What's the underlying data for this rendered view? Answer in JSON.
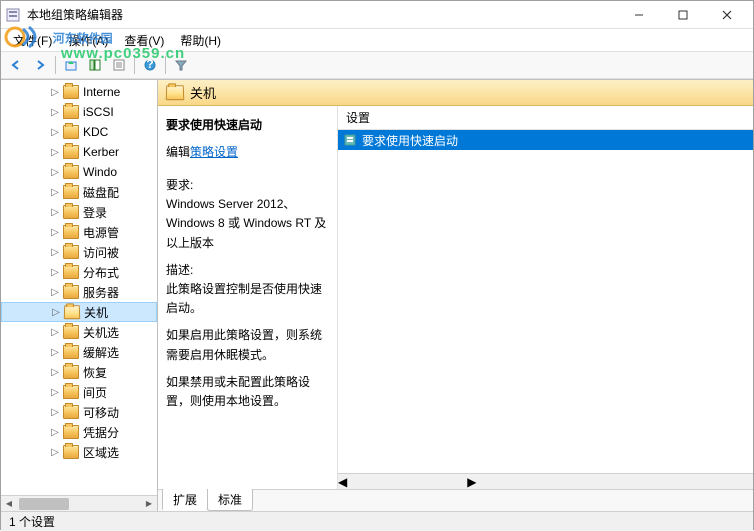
{
  "window": {
    "title": "本地组策略编辑器"
  },
  "menu": {
    "file": "文件(F)",
    "action": "操作(A)",
    "view": "查看(V)",
    "help": "帮助(H)"
  },
  "tree": {
    "items": [
      {
        "label": "Interne"
      },
      {
        "label": "iSCSI"
      },
      {
        "label": "KDC"
      },
      {
        "label": "Kerber"
      },
      {
        "label": "Windo"
      },
      {
        "label": "磁盘配"
      },
      {
        "label": "登录"
      },
      {
        "label": "电源管"
      },
      {
        "label": "访问被"
      },
      {
        "label": "分布式"
      },
      {
        "label": "服务器"
      },
      {
        "label": "关机"
      },
      {
        "label": "关机选"
      },
      {
        "label": "缓解选"
      },
      {
        "label": "恢复"
      },
      {
        "label": "间页"
      },
      {
        "label": "可移动"
      },
      {
        "label": "凭据分"
      },
      {
        "label": "区域选"
      }
    ],
    "selected_index": 11
  },
  "content": {
    "header": "关机",
    "policy_title": "要求使用快速启动",
    "edit_prefix": "编辑",
    "edit_link": "策略设置",
    "req_label": "要求:",
    "req_text": "Windows Server 2012、Windows 8 或 Windows RT 及以上版本",
    "desc_label": "描述:",
    "desc_text": "此策略设置控制是否使用快速启动。",
    "para1": "如果启用此策略设置，则系统需要启用休眠模式。",
    "para2": "如果禁用或未配置此策略设置，则使用本地设置。"
  },
  "list": {
    "col_setting": "设置",
    "items": [
      {
        "label": "要求使用快速启动"
      }
    ]
  },
  "tabs": {
    "extended": "扩展",
    "standard": "标准"
  },
  "status": {
    "text": "1 个设置"
  },
  "watermark": {
    "brand": "河东软件园",
    "url": "www.pc0359.cn"
  }
}
